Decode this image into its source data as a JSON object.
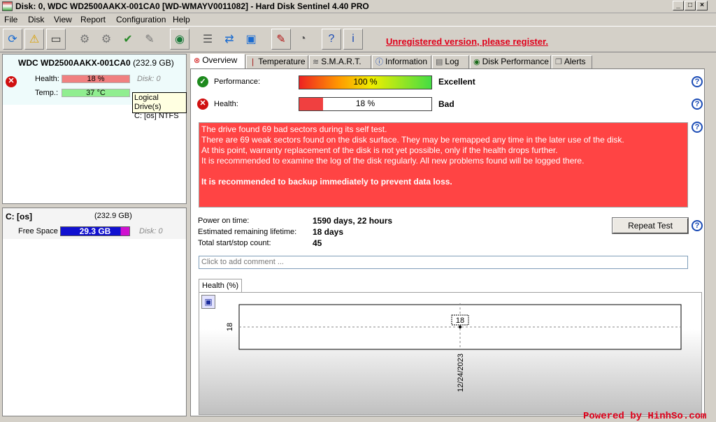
{
  "window": {
    "title": "Disk: 0, WDC WD2500AAKX-001CA0 [WD-WMAYV0011082]  -  Hard Disk Sentinel 4.40 PRO"
  },
  "menu": [
    "File",
    "Disk",
    "View",
    "Report",
    "Configuration",
    "Help"
  ],
  "toolbar": {
    "unregistered_label": "Unregistered version, please register."
  },
  "disk_panel": {
    "model": "WDC WD2500AAKX-001CA0",
    "size": "(232.9 GB)",
    "health_label": "Health:",
    "health_value": "18 %",
    "health_percent": 18,
    "health_disk_label": "Disk: 0",
    "temp_label": "Temp.:",
    "temp_value": "37 °C"
  },
  "tooltip": {
    "line1": "Logical Drive(s)",
    "line2": "C: [os] NTFS"
  },
  "volume_panel": {
    "name": "C: [os]",
    "size": "(232.9 GB)",
    "free_label": "Free Space",
    "free_value": "29.3 GB",
    "disk_label": "Disk: 0"
  },
  "tabs": [
    "Overview",
    "Temperature",
    "S.M.A.R.T.",
    "Information",
    "Log",
    "Disk Performance",
    "Alerts"
  ],
  "overview": {
    "performance_label": "Performance:",
    "performance_value": "100 %",
    "performance_percent": 100,
    "performance_rating": "Excellent",
    "health_label": "Health:",
    "health_value": "18 %",
    "health_percent": 18,
    "health_rating": "Bad",
    "messages": [
      "The drive found 69 bad sectors during its self test.",
      "There are 69 weak sectors found on the disk surface. They may be remapped any time in the later use of the disk.",
      "At this point, warranty replacement of the disk is not yet possible, only if the health drops further.",
      "It is recommended to examine the log of the disk regularly. All new problems found will be logged there."
    ],
    "warning": "It is recommended to backup immediately to prevent data loss.",
    "power_on_label": "Power on time:",
    "power_on_value": "1590 days, 22 hours",
    "lifetime_label": "Estimated remaining lifetime:",
    "lifetime_value": "18 days",
    "startstop_label": "Total start/stop count:",
    "startstop_value": "45",
    "repeat_test_label": "Repeat Test",
    "comment_placeholder": "Click to add comment ..."
  },
  "chart_tab_label": "Health (%)",
  "chart_data": {
    "type": "scatter",
    "x": [
      "12/24/2023"
    ],
    "y": [
      18
    ],
    "ylabel": "18",
    "data_labels": [
      "18"
    ],
    "x_tick_labels": [
      "12/24/2023"
    ],
    "y_tick_labels": [
      "18"
    ]
  },
  "footer": {
    "powered": "Powered by HinhSo.com"
  },
  "colors": {
    "health_bar": "#f08080",
    "temp_bar": "#90ee90",
    "free_bar": "#1010d0",
    "alert_box": "#ff4444",
    "unregistered": "#e0001a"
  }
}
